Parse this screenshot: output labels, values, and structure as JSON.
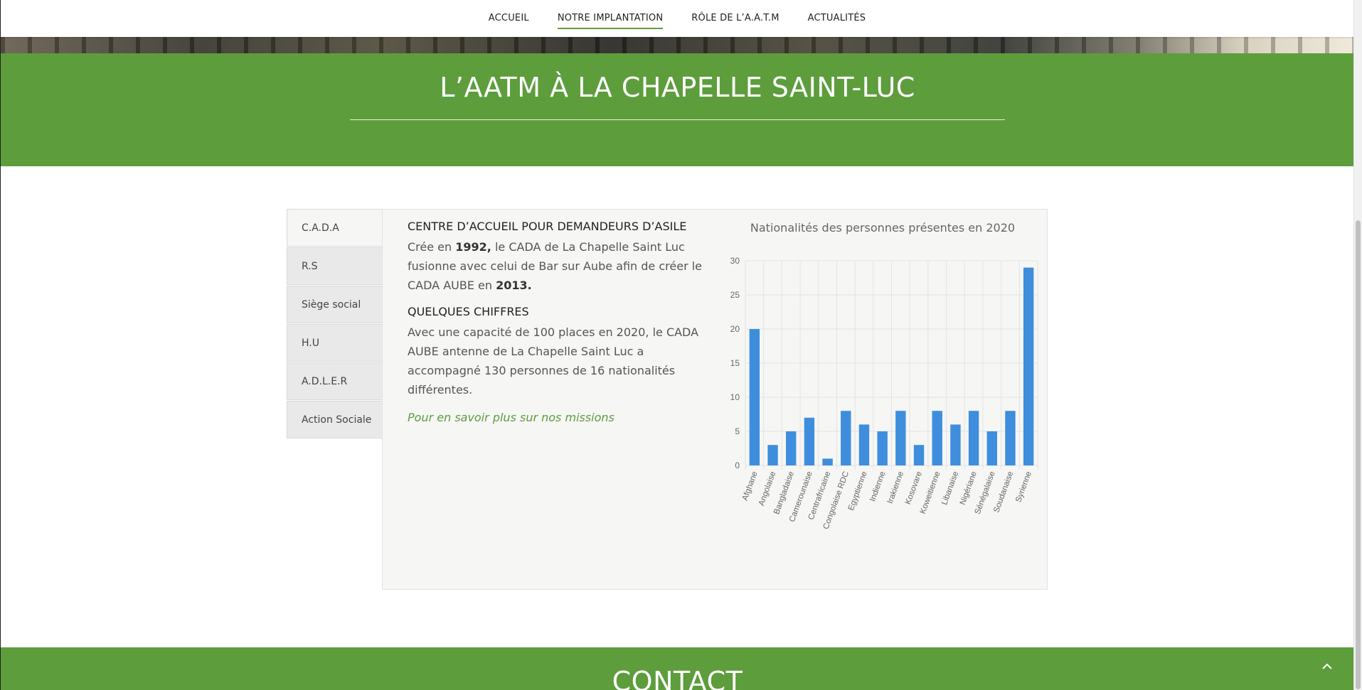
{
  "nav": {
    "items": [
      {
        "label": "ACCUEIL"
      },
      {
        "label": "NOTRE IMPLANTATION"
      },
      {
        "label": "RÔLE DE L’A.A.T.M"
      },
      {
        "label": "ACTUALITÉS"
      }
    ],
    "active_index": 1
  },
  "page": {
    "title": "L’AATM À LA CHAPELLE SAINT-LUC",
    "accent_color": "#5d9d3c"
  },
  "tabs": {
    "items": [
      {
        "label": "C.A.D.A"
      },
      {
        "label": "R.S"
      },
      {
        "label": "Siège social"
      },
      {
        "label": "H.U"
      },
      {
        "label": "A.D.L.E.R"
      },
      {
        "label": "Action Sociale"
      }
    ],
    "active_index": 0
  },
  "content": {
    "heading1": "CENTRE D’ACCUEIL POUR DEMANDEURS D’ASILE",
    "p1_a": "Crée en ",
    "p1_year1": "1992,",
    "p1_b": " le CADA de La Chapelle Saint Luc fusionne avec celui de Bar sur Aube afin de créer le CADA AUBE en ",
    "p1_year2": "2013.",
    "heading2": "QUELQUES CHIFFRES",
    "p2": "Avec une capacité de 100 places en 2020, le CADA AUBE antenne de La Chapelle Saint Luc a accompagné 130 personnes de 16 nationalités différentes.",
    "link": "Pour en savoir plus sur nos missions"
  },
  "chart_data": {
    "type": "bar",
    "title": "Nationalités des personnes présentes en 2020",
    "categories": [
      "Afghane",
      "Angolaise",
      "Bangladaise",
      "Camerounaise",
      "Centrafricaine",
      "Congolaise RDC",
      "Egyptienne",
      "Indienne",
      "Irakienne",
      "Kosovare",
      "Koweitienne",
      "Libanaise",
      "Nigériane",
      "Sénégalaise",
      "Soudanaise",
      "Syrienne"
    ],
    "values": [
      20,
      3,
      5,
      7,
      1,
      8,
      6,
      5,
      8,
      3,
      8,
      6,
      8,
      5,
      8,
      29
    ],
    "ylim": [
      0,
      30
    ],
    "yticks": [
      "0",
      "5",
      "10",
      "15",
      "20",
      "25",
      "30"
    ],
    "bar_color": "#3e8edd",
    "grid": true,
    "legend": "none"
  },
  "footer": {
    "contact_title": "CONTACT"
  },
  "icons": {
    "back_to_top": "chevron-up-icon"
  }
}
